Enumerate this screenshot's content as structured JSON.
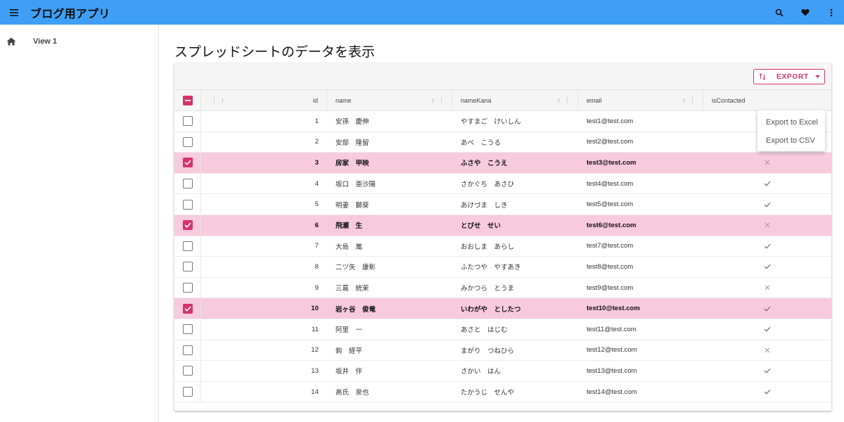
{
  "app": {
    "title": "ブログ用アプリ"
  },
  "appbar_icons": [
    "menu-icon",
    "search-icon",
    "heart-icon",
    "more-vert-icon"
  ],
  "sidebar": {
    "items": [
      {
        "label": "View 1",
        "icon": "home-icon"
      }
    ]
  },
  "page": {
    "title": "スプレッドシートのデータを表示"
  },
  "toolbar": {
    "export_label": "EXPORT"
  },
  "export_menu": {
    "excel": "Export to Excel",
    "csv": "Export to CSV"
  },
  "columns": {
    "id": "id",
    "name": "name",
    "kana": "nameKana",
    "email": "email",
    "contacted": "isContacted"
  },
  "colors": {
    "appbar": "#3f9ff7",
    "accent": "#d6336c",
    "selected_row": "#f7cadc"
  },
  "rows": [
    {
      "id": "1",
      "name": "安孫　慶伸",
      "kana": "やすまご　けいしん",
      "email": "test1@test.com",
      "contacted": true,
      "selected": false
    },
    {
      "id": "2",
      "name": "安部　隆留",
      "kana": "あべ　こうる",
      "email": "test2@test.com",
      "contacted": true,
      "selected": false
    },
    {
      "id": "3",
      "name": "房家　甲映",
      "kana": "ふさや　こうえ",
      "email": "test3@test.com",
      "contacted": false,
      "selected": true
    },
    {
      "id": "4",
      "name": "坂口　亜沙陽",
      "kana": "さかぐち　あさひ",
      "email": "test4@test.com",
      "contacted": true,
      "selected": false
    },
    {
      "id": "5",
      "name": "明妻　獅葵",
      "kana": "あけづま　しき",
      "email": "test5@test.com",
      "contacted": true,
      "selected": false
    },
    {
      "id": "6",
      "name": "飛瀬　生",
      "kana": "とびせ　せい",
      "email": "test6@test.com",
      "contacted": false,
      "selected": true
    },
    {
      "id": "7",
      "name": "大島　嵐",
      "kana": "おおしま　あらし",
      "email": "test7@test.com",
      "contacted": true,
      "selected": false
    },
    {
      "id": "8",
      "name": "二ツ矢　康彰",
      "kana": "ふたつや　やすあき",
      "email": "test8@test.com",
      "contacted": true,
      "selected": false
    },
    {
      "id": "9",
      "name": "三葛　統茉",
      "kana": "みかつら　とうま",
      "email": "test9@test.com",
      "contacted": false,
      "selected": false
    },
    {
      "id": "10",
      "name": "岩ヶ谷　俊竜",
      "kana": "いわがや　としたつ",
      "email": "test10@test.com",
      "contacted": true,
      "selected": true
    },
    {
      "id": "11",
      "name": "阿里　一",
      "kana": "あさと　はじむ",
      "email": "test11@test.com",
      "contacted": true,
      "selected": false
    },
    {
      "id": "12",
      "name": "鉤　経平",
      "kana": "まがり　つねひら",
      "email": "test12@test.com",
      "contacted": false,
      "selected": false
    },
    {
      "id": "13",
      "name": "坂井　伴",
      "kana": "さかい　はん",
      "email": "test13@test.com",
      "contacted": true,
      "selected": false
    },
    {
      "id": "14",
      "name": "高氏　泉也",
      "kana": "たかうじ　せんや",
      "email": "test14@test.com",
      "contacted": true,
      "selected": false
    }
  ]
}
